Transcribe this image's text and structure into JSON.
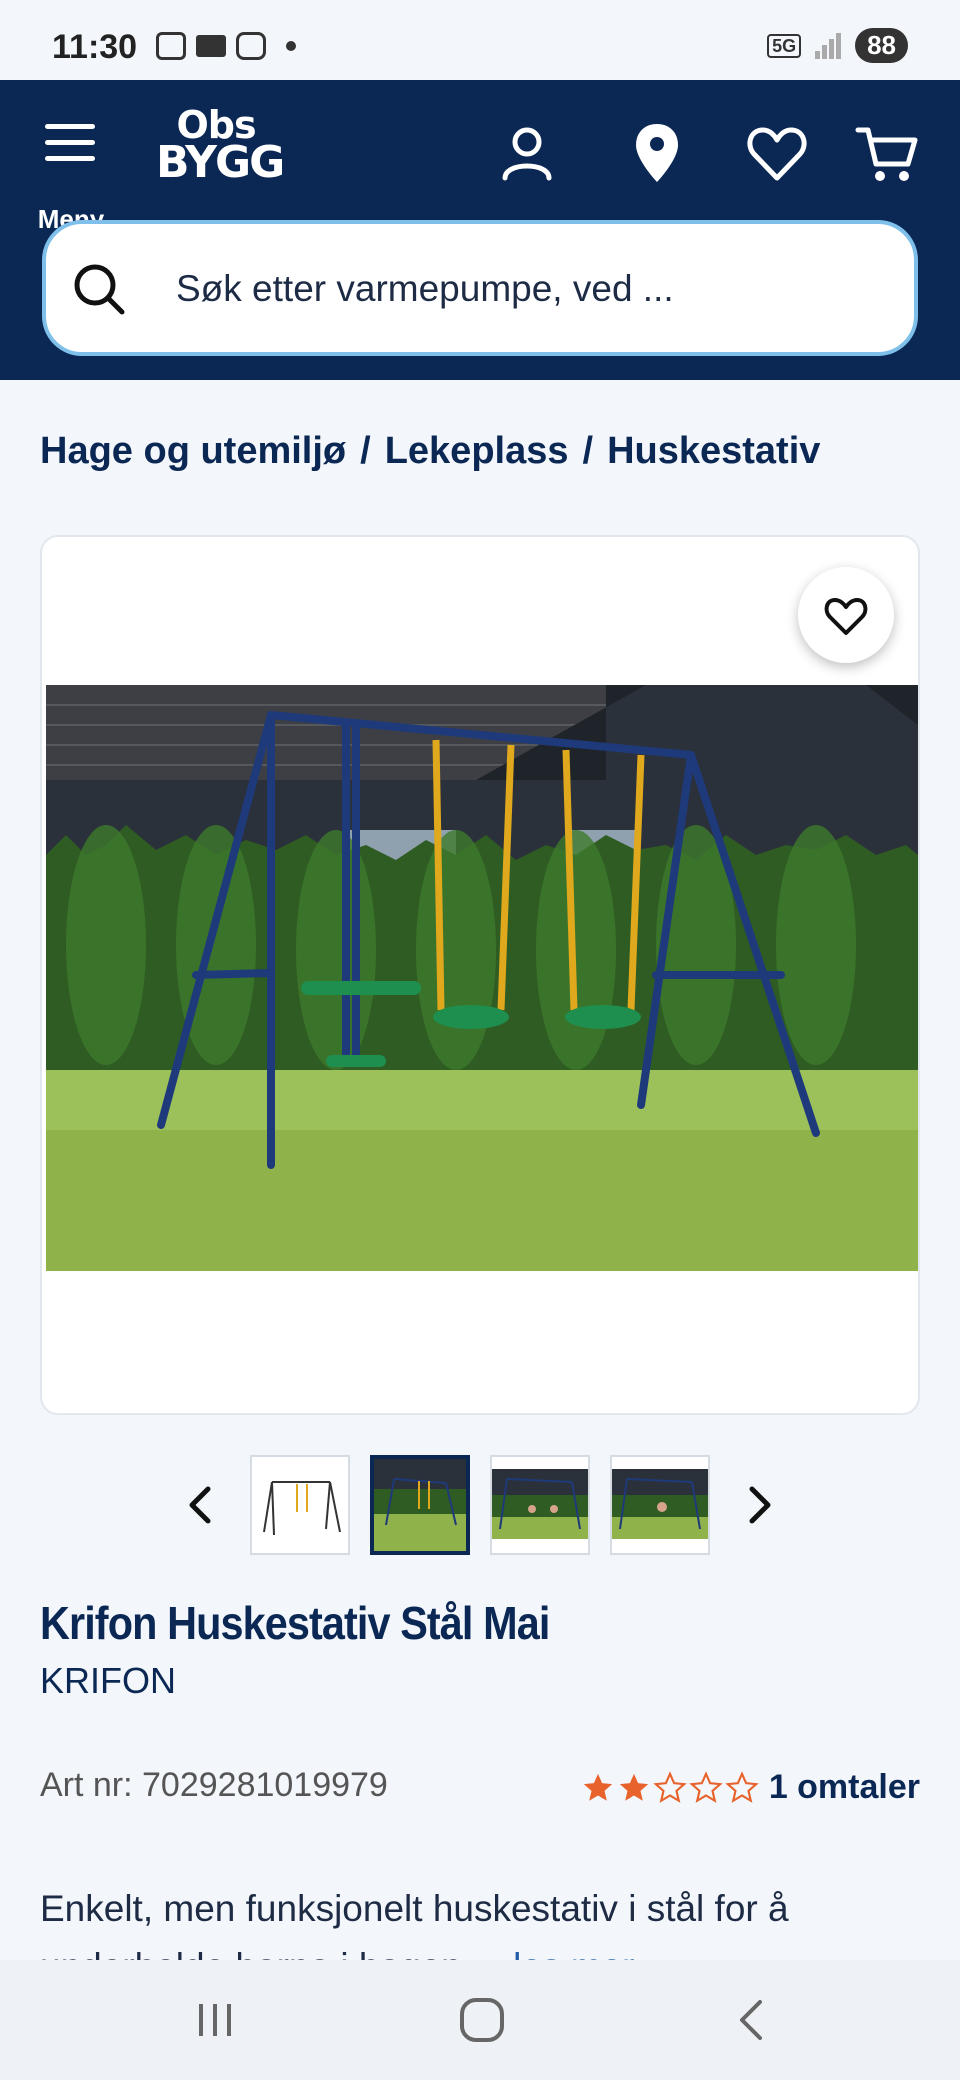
{
  "status_bar": {
    "time": "11:30",
    "battery": "88",
    "network": "5G"
  },
  "header": {
    "menu_label": "Meny",
    "logo_top": "Obs",
    "logo_bottom": "BYGG",
    "search_placeholder": "Søk etter varmepumpe, ved ..."
  },
  "breadcrumb": [
    "Hage og utemiljø",
    "/",
    "Lekeplass",
    "/",
    "Huskestativ"
  ],
  "product": {
    "title": "Krifon Huskestativ Stål Mai",
    "brand": "KRIFON",
    "art_nr": "Art nr: 7029281019979",
    "rating": 2,
    "rating_max": 5,
    "reviews": "1 omtaler",
    "description": "Enkelt, men funksjonelt huskestativ i stål for å underholde barna i hagen ...",
    "read_more": "les mer"
  },
  "gallery": {
    "thumbnail_count": 4,
    "active_index": 1
  },
  "colors": {
    "brand_navy": "#0b2855",
    "star_orange": "#e8622c",
    "accent_blue": "#7fc0ea"
  }
}
